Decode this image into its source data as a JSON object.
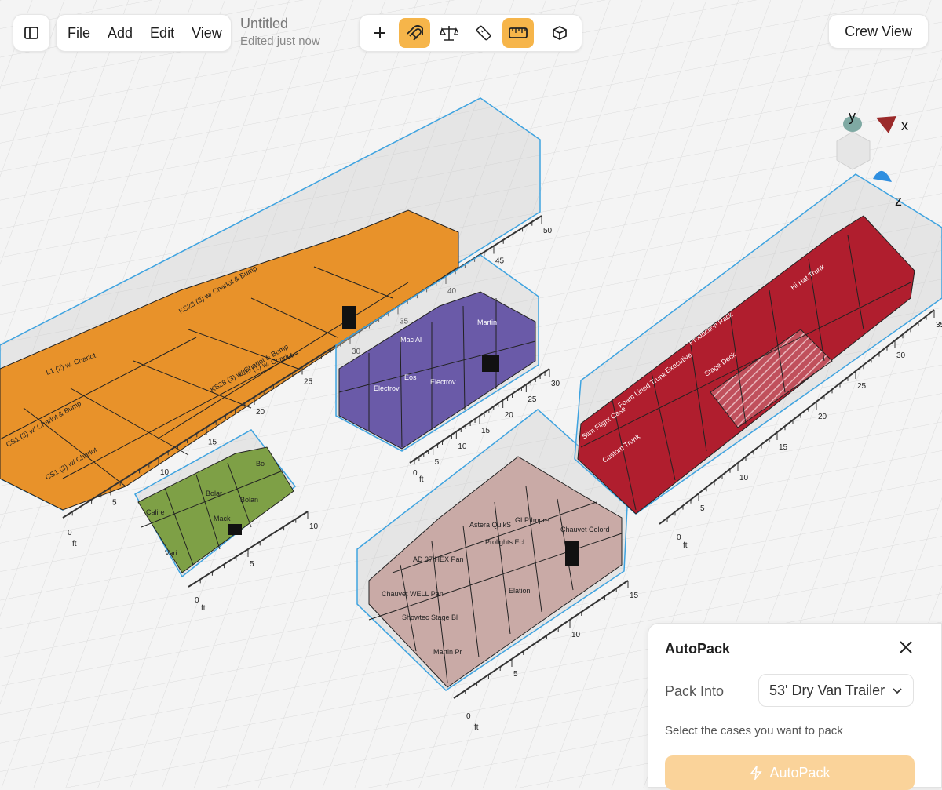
{
  "toolbar": {
    "menu": [
      "File",
      "Add",
      "Edit",
      "View"
    ],
    "doc_title": "Untitled",
    "doc_status": "Edited just now",
    "tools": [
      {
        "name": "add",
        "icon": "plus-icon",
        "active": false
      },
      {
        "name": "magnet",
        "icon": "magnet-icon",
        "active": true
      },
      {
        "name": "weight",
        "icon": "scale-icon",
        "active": false
      },
      {
        "name": "measure",
        "icon": "ruler-icon",
        "active": false
      },
      {
        "name": "dimensions",
        "icon": "tape-measure-icon",
        "active": true
      },
      {
        "name": "box",
        "icon": "box-icon",
        "active": false
      }
    ],
    "accent_color": "#f6b54a"
  },
  "crew_view_label": "Crew View",
  "axes": {
    "x": "x",
    "y": "y",
    "z": "z"
  },
  "unit_label": "ft",
  "containers": [
    {
      "id": "orange",
      "color": "#e8922a",
      "ticks": [
        "5",
        "10",
        "15",
        "20",
        "25",
        "30",
        "35",
        "40",
        "45",
        "50"
      ],
      "labels": [
        "CS1 (3) w/ Charlot & Bump",
        "L1 (2) w/ Charlot",
        "KS28 (3) w/ Charlot & Bump",
        "CS1 (3) w/ Charlot",
        "L1D (1) w/ Charlot",
        "KS28 (3) w/ Charlot & Bump"
      ]
    },
    {
      "id": "purple",
      "color": "#6a5aa8",
      "ticks": [
        "5",
        "10",
        "15",
        "20",
        "25",
        "30"
      ],
      "labels": [
        "Electrov",
        "Mac Al",
        "Eos",
        "Martin",
        "Electrov"
      ]
    },
    {
      "id": "green",
      "color": "#7ea046",
      "ticks": [
        "5",
        "10"
      ],
      "labels": [
        "Calire",
        "Bolar",
        "Mack",
        "Bolan",
        "Bo",
        "Vari"
      ]
    },
    {
      "id": "pink",
      "color": "#c9aaa6",
      "ticks": [
        "5",
        "10",
        "15"
      ],
      "labels": [
        "Chauvet WELL Pan",
        "AD 37 HEX Pan",
        "Astera QuikS",
        "Chauvet Colord",
        "GLP Impre",
        "Prolights Ecl",
        "Elation",
        "Showtec Stage Bl",
        "Martin Pr"
      ]
    },
    {
      "id": "red",
      "color": "#b01e2e",
      "ticks": [
        "5",
        "10",
        "15",
        "20",
        "25",
        "30",
        "35"
      ],
      "labels": [
        "Slim Flight Case",
        "Foam Lined Trunk",
        "Custom Trunk",
        "Production Rack",
        "Executive",
        "Stage Deck",
        "Hi Hat Trunk"
      ]
    }
  ],
  "autopack": {
    "title": "AutoPack",
    "pack_into_label": "Pack Into",
    "pack_into_value": "53' Dry Van Trailer",
    "hint": "Select the cases you want to pack",
    "button_label": "AutoPack"
  }
}
